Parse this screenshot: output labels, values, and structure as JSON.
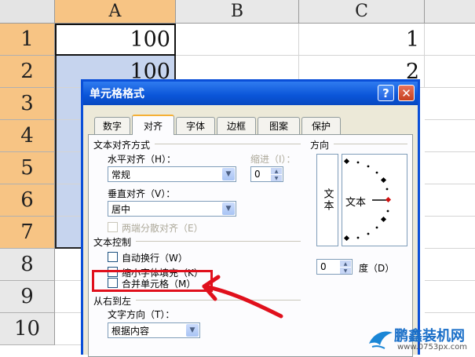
{
  "sheet": {
    "columns": [
      "A",
      "B",
      "C"
    ],
    "rows": [
      "1",
      "2",
      "3",
      "4",
      "5",
      "6",
      "7",
      "8",
      "9",
      "10"
    ],
    "cells": {
      "a1": "100",
      "a2": "100",
      "c1": "1",
      "c2": "2"
    },
    "colors": {
      "header_selected": "#f7c484",
      "selection": "#c6d4ee"
    }
  },
  "dialog": {
    "title": "单元格格式",
    "help_glyph": "?",
    "close_glyph": "✕",
    "tabs": [
      "数字",
      "对齐",
      "字体",
      "边框",
      "图案",
      "保护"
    ],
    "active_tab": "对齐",
    "text_alignment": {
      "group_label": "文本对齐方式",
      "horizontal_label": "水平对齐（H）：",
      "horizontal_value": "常规",
      "indent_label": "缩进（I）：",
      "indent_value": "0",
      "vertical_label": "垂直对齐（V）：",
      "vertical_value": "居中",
      "justify_distributed_label": "两端分散对齐（E）"
    },
    "text_control": {
      "group_label": "文本控制",
      "wrap_text_label": "自动换行（W）",
      "shrink_to_fit_label": "缩小字体填充（K）",
      "merge_cells_label": "合并单元格（M）"
    },
    "right_to_left": {
      "group_label": "从右到左",
      "direction_label": "文字方向（T）：",
      "direction_value": "根据内容"
    },
    "orientation": {
      "group_label": "方向",
      "vertical_text": "文本",
      "horizontal_text": "文本",
      "degrees_value": "0",
      "degrees_label": "度（D）"
    }
  },
  "watermark": {
    "brand": "鹏鑫装机网",
    "url": "www.0753px.com"
  },
  "annotation": {
    "highlight_color": "#e0101c"
  }
}
